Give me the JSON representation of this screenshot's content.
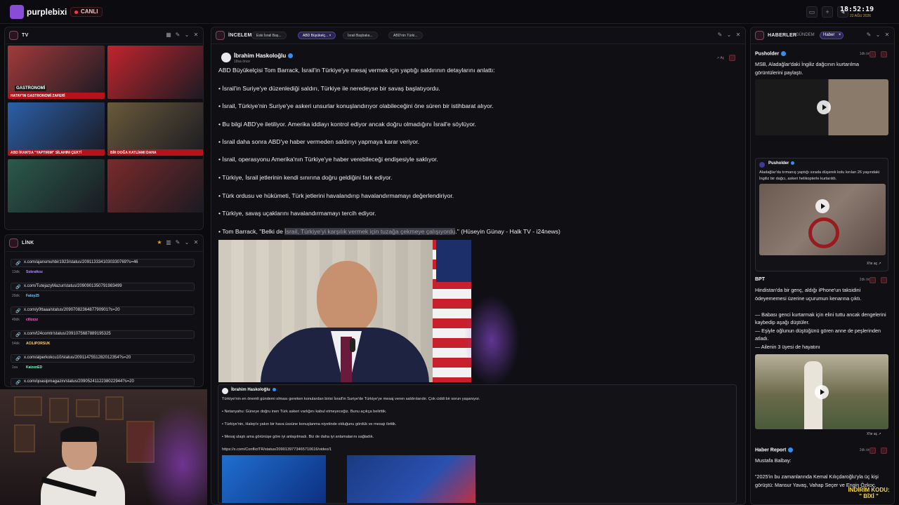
{
  "topbar": {
    "brand": "purplebixi",
    "live": "CANLI",
    "time": "18:52:19",
    "date": "22 AĞU 2026"
  },
  "tv": {
    "title": "TV",
    "tiles": [
      {
        "label": "GASTRONOMİ",
        "bar": "HATAY'IN GASTRONOMİ ZAFERİ",
        "bg": "#a33a3a"
      },
      {
        "label": "",
        "bar": "",
        "bg": "#c2242d"
      },
      {
        "label": "",
        "bar": "ABD İRAN'DA \"YAPTIRIM\" SİLAHINI ÇEKTİ",
        "bg": "#2b5fa8"
      },
      {
        "label": "",
        "bar": "BİR DOĞA KATLİAMI DAHA",
        "bg": "#6a5a3a"
      },
      {
        "label": "",
        "bar": "",
        "bg": "#2a5a4a"
      },
      {
        "label": "",
        "bar": "",
        "bg": "#7a2a2a"
      }
    ]
  },
  "link": {
    "title": "LİNK",
    "items": [
      {
        "url": "x.com/ajansmuhbir1923/status/2091133341030330769?s=46",
        "meta": "13dk",
        "user": "Sokratkoz",
        "color": "#b58cff"
      },
      {
        "url": "x.com/TutejazyMazur/status/2090901350791983499",
        "meta": "29dk",
        "user": "Fatoy25",
        "color": "#6ad0ff"
      },
      {
        "url": "x.com/y0ttaaa/status/2090708236487790901?s=20",
        "meta": "49dk",
        "user": "cilizzzz",
        "color": "#ff6ad5"
      },
      {
        "url": "x.com/t24comtr/status/2091075687889195325",
        "meta": "54dk",
        "user": "ACILIPORSUK",
        "color": "#ffd75a"
      },
      {
        "url": "x.com/alperkokcu10/status/2091147551282012354?s=20",
        "meta": "1sa",
        "user": "KaizenED",
        "color": "#7affc4"
      },
      {
        "url": "x.com/qoasipmagazin/status/2090524112238022944?s=20",
        "meta": "",
        "user": "",
        "color": "#ffffff"
      }
    ]
  },
  "review": {
    "title": "İNCELEME",
    "tabs": [
      {
        "label": "Eski İsrail Baş...",
        "active": false
      },
      {
        "label": "ABD Büyükelç...",
        "active": true
      },
      {
        "label": "İsrail Başbaka...",
        "active": false
      },
      {
        "label": "ABD'nin Türki...",
        "active": false
      }
    ],
    "post": {
      "author": "İbrahim Haskoloğlu",
      "ago": "18sa önce",
      "open": "Aç",
      "lines": [
        "ABD Büyükelçisi Tom Barrack, İsrail'in Türkiye'ye mesaj vermek için yaptığı saldırının detaylarını anlattı:",
        "• İsrail'in Suriye'ye düzenlediği saldırı, Türkiye ile neredeyse bir savaş başlatıyordu.",
        "• İsrail, Türkiye'nin Suriye'ye askeri unsurlar konuşlandırıyor olabileceğini öne süren bir istihbarat alıyor.",
        "• Bu bilgi ABD'ye iletiliyor. Amerika iddiayı kontrol ediyor ancak doğru olmadığını İsrail'e söylüyor.",
        "• İsrail daha sonra ABD'ye haber vermeden saldırıyı yapmaya karar veriyor.",
        "• İsrail, operasyonu Amerika'nın Türkiye'ye haber verebileceği endişesiyle saklıyor.",
        "• Türkiye, İsrail jetlerinin kendi sınırına doğru geldiğini fark ediyor.",
        "• Türk ordusu ve hükümeti, Türk jetlerini havalandırıp havalandırmamayı değerlendiriyor.",
        "• Türkiye, savaş uçaklarını havalandırmamayı tercih ediyor."
      ],
      "last_pre": "• Tom Barrack, \"Belki de ",
      "last_hl": "İsrail, Türkiye'yi karşılık vermek için tuzağa çekmeye çalışıyordu",
      "last_post": ".\" (Hüseyin Günay - Halk TV - i24news)"
    },
    "quote": {
      "author": "İbrahim Haskoloğlu",
      "lines": [
        "Türkiye'nin en önemli gündemi olması gereken konulardan birisi İsrail'in Suriye'de Türkiye'ye mesaj veren saldırılarıdır. Çok ciddi bir sorun yaşanıyor.",
        "• Netanyahu: Güneye doğru inen Türk askeri varlığını kabul etmeyeceğiz. Bunu açıkça belirttik.",
        "• Türkiye'nin, Halep'e yakın bir hava üssüne konuşlanma niyetinde olduğunu gördük ve mesajı ilettik.",
        "• Mesaj ulaştı ama görünüşe göre iyi anlaşılmadı. Biz de daha iyi anlamalarını sağladık.",
        "https://x.com/ConflictTR/status/2090139773465710616/video/1"
      ]
    }
  },
  "news": {
    "title": "HABERLER",
    "tabs": [
      "GÜNDEM",
      "Haber"
    ],
    "items": [
      {
        "source": "Pusholder",
        "time": "1dk önce",
        "text": "MSB, Aladağlar'daki İngiliz dağcının kurtarılma görüntülerini paylaştı.",
        "embed_source": "Pusholder",
        "embed_text": "Aladağlar'da tırmanış yaptığı sırada düşerek kolu kırılan 26 yaşındaki İngiliz bir dağcı, askeri helikopterle kurtarıldı.",
        "link": "X'te aç"
      },
      {
        "source": "BPT",
        "time": "2dk önce",
        "text": "Hindistan'da bir genç, aldığı iPhone'un taksidini ödeyememesi üzerine uçurumun kenarına çıktı.\n\n— Babası genci kurtarmak için elini tuttu ancak dengelerini kaybedip aşağı düştüler.\n— Eşiyle oğlunun düştüğünü gören anne de peşlerinden atladı.\n— Ailenin 3 üyesi de hayatını",
        "link": "X'te aç"
      },
      {
        "source": "Haber Report",
        "time": "2dk önce",
        "text": "Mustafa Balbay:\n\n\"2025'in bu zamanlarında Kemal Kılıçdaroğlu'yla üç kişi görüştü: Mansur Yavaş, Vahap Seçer ve Engin Özkoç."
      }
    ]
  },
  "promo": {
    "line1": "İNDİRİM KODU:",
    "line2": "\" BİXİ \""
  },
  "colors": {
    "accent": "#8a4bd8",
    "live": "#ef3b4a",
    "verified": "#3a8eea"
  }
}
